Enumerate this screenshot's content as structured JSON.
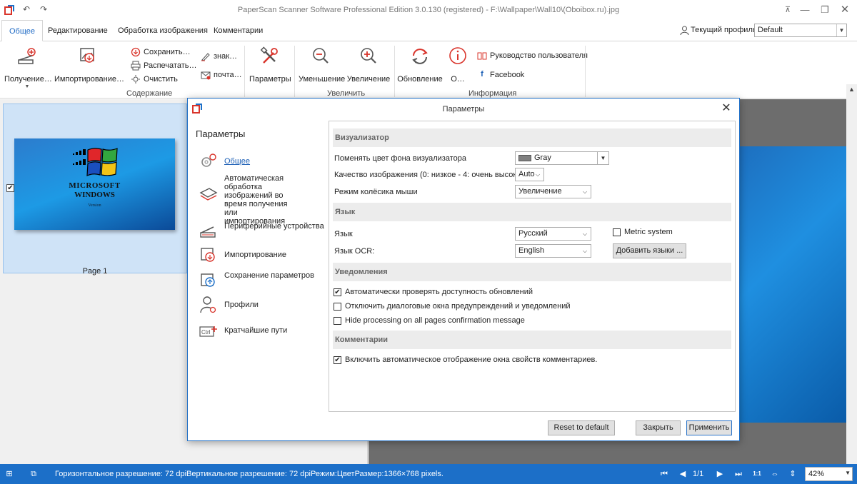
{
  "window": {
    "title": "PaperScan Scanner Software Professional Edition 3.0.130 (registered) - F:\\Wallpaper\\Wall10\\(Oboibox.ru).jpg"
  },
  "ribbon_tabs": [
    {
      "label": "Общее",
      "active": true
    },
    {
      "label": "Редактирование",
      "active": false
    },
    {
      "label": "Обработка изображения",
      "active": false
    },
    {
      "label": "Комментарии",
      "active": false
    }
  ],
  "profile": {
    "label": "Текущий профиль:",
    "value": "Default"
  },
  "ribbon": {
    "acquire": "Получение…",
    "import": "Импортирование…",
    "save": "Сохранить…",
    "print": "Распечатать…",
    "clear": "Очистить",
    "sign": "знак…",
    "mail": "почта…",
    "settings": "Параметры",
    "group_content": "Содержание",
    "zoom_out": "Уменьшение",
    "zoom_in": "Увеличение",
    "group_zoom": "Увеличить",
    "update": "Обновление",
    "about": "О…",
    "manual": "Руководство пользователя",
    "facebook": "Facebook",
    "group_info": "Информация"
  },
  "thumbnail": {
    "page_label": "Page 1",
    "checked": true,
    "logo_line1": "MICROSOFT",
    "logo_line2": "WINDOWS",
    "version": "Version"
  },
  "dialog": {
    "title": "Параметры",
    "heading": "Параметры",
    "nav": [
      {
        "label": "Общее",
        "icon": "gears-icon",
        "active": true
      },
      {
        "label": "Автоматическая обработка изображений во время получения или импортирования",
        "icon": "stack-icon"
      },
      {
        "label": "Периферийные устройства",
        "icon": "scanner-icon"
      },
      {
        "label": "Импортирование",
        "icon": "import-icon"
      },
      {
        "label": "Сохранение параметров",
        "icon": "save-icon"
      },
      {
        "label": "Профили",
        "icon": "user-gear-icon"
      },
      {
        "label": "Кратчайшие пути",
        "icon": "ctrl-shortcut-icon"
      }
    ],
    "sections": {
      "visualizer": "Визуализатор",
      "language": "Язык",
      "notifications": "Уведомления",
      "comments": "Комментарии"
    },
    "visualizer": {
      "bg_label": "Поменять цвет фона визуализатора",
      "bg_value": "Gray",
      "bg_color": "#808080",
      "quality_label": "Качество изображения (0: низкое - 4: очень высокое)",
      "quality_value": "Auto",
      "wheel_label": "Режим колёсика мыши",
      "wheel_value": "Увеличение"
    },
    "language": {
      "lang_label": "Язык",
      "lang_value": "Русский",
      "metric_label": "Metric system",
      "metric_checked": false,
      "ocr_label": "Язык OCR:",
      "ocr_value": "English",
      "add_lang_button": "Добавить языки ..."
    },
    "notifications": {
      "auto_update": "Автоматически проверять доступность обновлений",
      "auto_update_checked": true,
      "disable_dialogs": "Отключить диалоговые окна предупреждений и уведомлений",
      "disable_dialogs_checked": false,
      "hide_processing": "Hide processing on all pages confirmation message",
      "hide_processing_checked": false
    },
    "comments": {
      "auto_show": "Включить автоматическое отображение окна свойств комментариев.",
      "auto_show_checked": true
    },
    "buttons": {
      "reset": "Reset to default",
      "close": "Закрыть",
      "apply": "Применить"
    }
  },
  "statusbar": {
    "text": "Горизонтальное разрешение: 72 dpiВертикальное разрешение: 72 dpiРежим:ЦветРазмер:1366×768 pixels.",
    "page": "1/1",
    "zoom": "42%"
  },
  "colors": {
    "accent": "#1c6fc8",
    "brand_red": "#d9342b"
  }
}
